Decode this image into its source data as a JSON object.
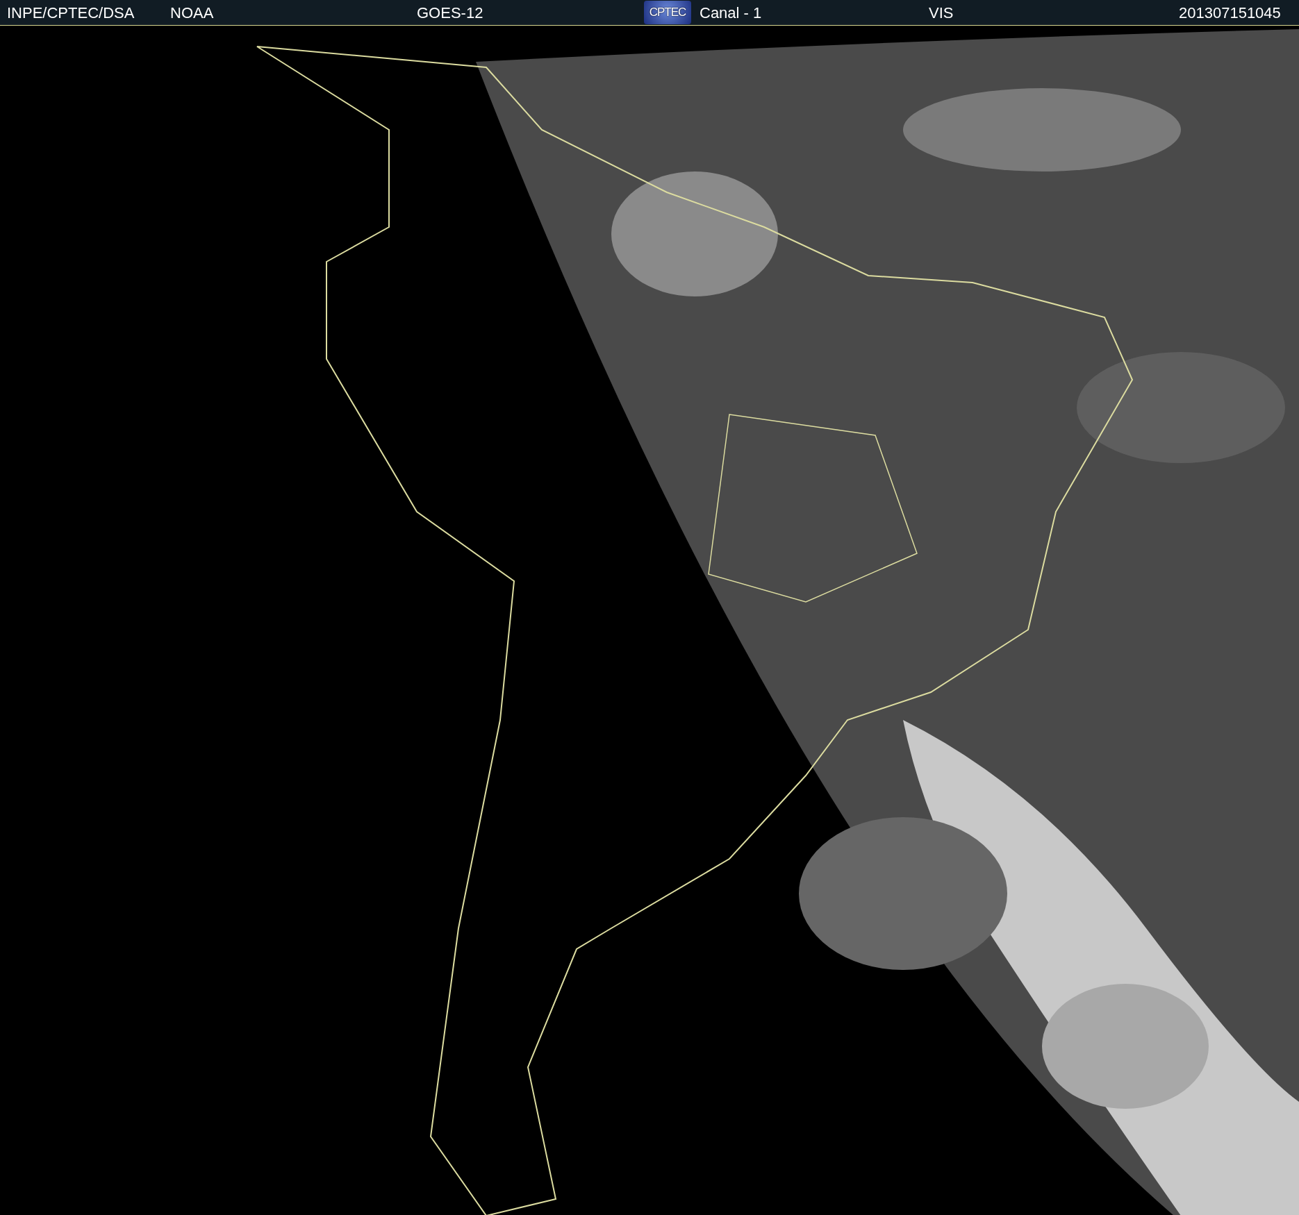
{
  "header": {
    "source": "INPE/CPTEC/DSA",
    "agency": "NOAA",
    "satellite": "GOES-12",
    "logo": "CPTEC",
    "channel": "Canal - 1",
    "band": "VIS",
    "timestamp": "201307151045"
  }
}
